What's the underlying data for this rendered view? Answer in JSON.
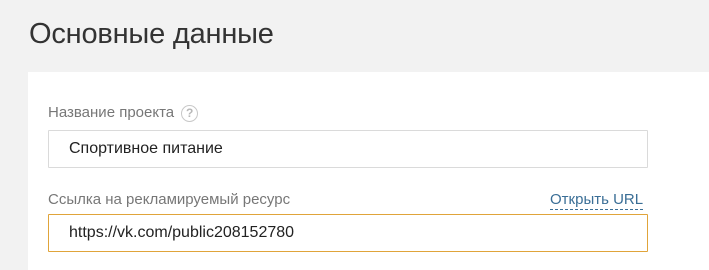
{
  "page": {
    "title": "Основные данные"
  },
  "form": {
    "project_name": {
      "label": "Название проекта",
      "help_icon": "question-circle-icon",
      "help_glyph": "?",
      "value": "Спортивное питание"
    },
    "resource_url": {
      "label": "Ссылка на рекламируемый ресурс",
      "open_link": "Открыть URL",
      "value": "https://vk.com/public208152780",
      "focused": true
    }
  },
  "colors": {
    "page_background": "#f2f2f2",
    "card_background": "#ffffff",
    "focus_border": "#e0a43a",
    "link": "#3a6e96"
  }
}
